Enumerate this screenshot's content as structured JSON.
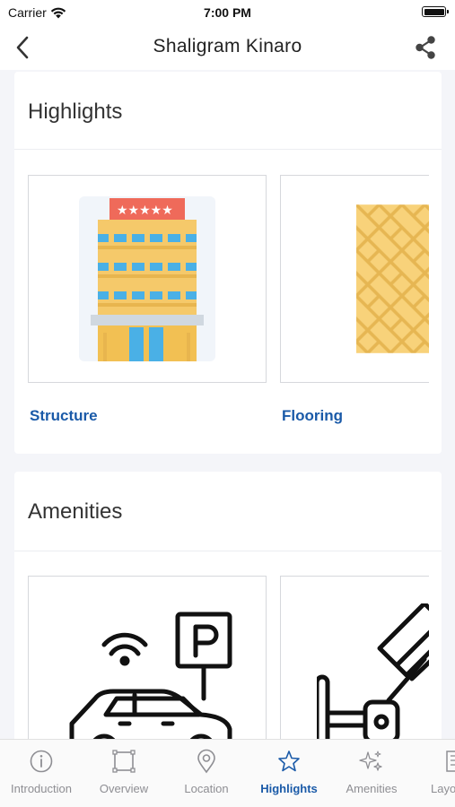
{
  "status_bar": {
    "carrier": "Carrier",
    "time": "7:00 PM"
  },
  "header": {
    "title": "Shaligram Kinaro",
    "back_icon": "chevron-left-icon",
    "share_icon": "share-icon"
  },
  "highlights": {
    "title": "Highlights",
    "cards": [
      {
        "label": "Structure",
        "icon": "hotel-building-icon"
      },
      {
        "label": "Flooring",
        "icon": "parquet-floor-icon"
      }
    ]
  },
  "amenities": {
    "title": "Amenities",
    "cards": [
      {
        "label": "",
        "icon": "parking-car-icon"
      },
      {
        "label": "",
        "icon": "security-camera-icon"
      }
    ]
  },
  "tabs": [
    {
      "label": "Introduction",
      "icon": "info-icon",
      "active": false
    },
    {
      "label": "Overview",
      "icon": "square-frame-icon",
      "active": false
    },
    {
      "label": "Location",
      "icon": "location-pin-icon",
      "active": false
    },
    {
      "label": "Highlights",
      "icon": "star-icon",
      "active": true
    },
    {
      "label": "Amenities",
      "icon": "sparkle-icon",
      "active": false
    },
    {
      "label": "Layo",
      "icon": "layout-icon",
      "active": false
    }
  ],
  "colors": {
    "accent": "#1a5aa8",
    "inactive": "#8e8e93",
    "building_yellow": "#f5c96a",
    "roof_red": "#ef6a5a",
    "window_blue": "#4ab0e6"
  }
}
